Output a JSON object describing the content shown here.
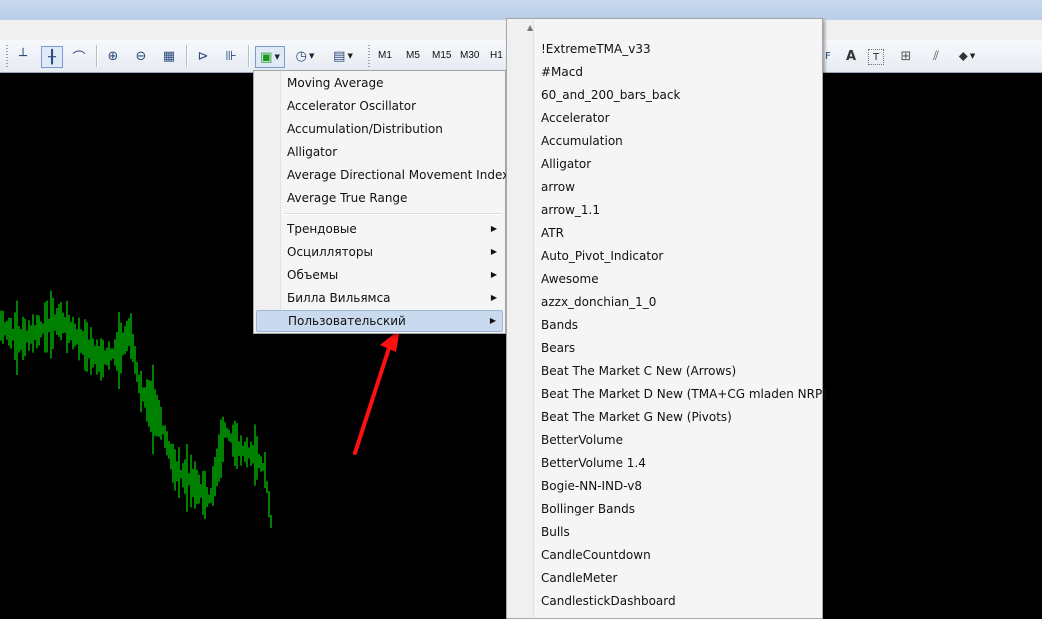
{
  "toolbar": {
    "timeframes": [
      "M1",
      "M5",
      "M15",
      "M30",
      "H1"
    ],
    "right_icons": [
      "A",
      "T"
    ]
  },
  "indicator_menu": {
    "items": [
      {
        "label": "Moving Average"
      },
      {
        "label": "Accelerator Oscillator"
      },
      {
        "label": "Accumulation/Distribution"
      },
      {
        "label": "Alligator"
      },
      {
        "label": "Average Directional Movement Index"
      },
      {
        "label": "Average True Range"
      }
    ],
    "groups": [
      {
        "label": "Трендовые"
      },
      {
        "label": "Осцилляторы"
      },
      {
        "label": "Объемы"
      },
      {
        "label": "Билла Вильямса"
      },
      {
        "label": "Пользовательский",
        "highlighted": true
      }
    ]
  },
  "custom_menu": {
    "items": [
      "!ExtremeTMA_v33",
      "#Macd",
      "60_and_200_bars_back",
      "Accelerator",
      "Accumulation",
      "Alligator",
      "arrow",
      "arrow_1.1",
      "ATR",
      "Auto_Pivot_Indicator",
      "Awesome",
      "azzx_donchian_1_0",
      "Bands",
      "Bears",
      "Beat The Market C New (Arrows)",
      "Beat The Market D New (TMA+CG mladen NRP)",
      "Beat The Market G New (Pivots)",
      "BetterVolume",
      "BetterVolume 1.4",
      "Bogie-NN-IND-v8",
      "Bollinger Bands",
      "Bulls",
      "CandleCountdown",
      "CandleMeter",
      "CandlestickDashboard"
    ]
  },
  "colors": {
    "chart_bg": "#000000",
    "bars": "#00ff00",
    "highlight": "#c9d9ee",
    "arrow": "#ff1010"
  }
}
